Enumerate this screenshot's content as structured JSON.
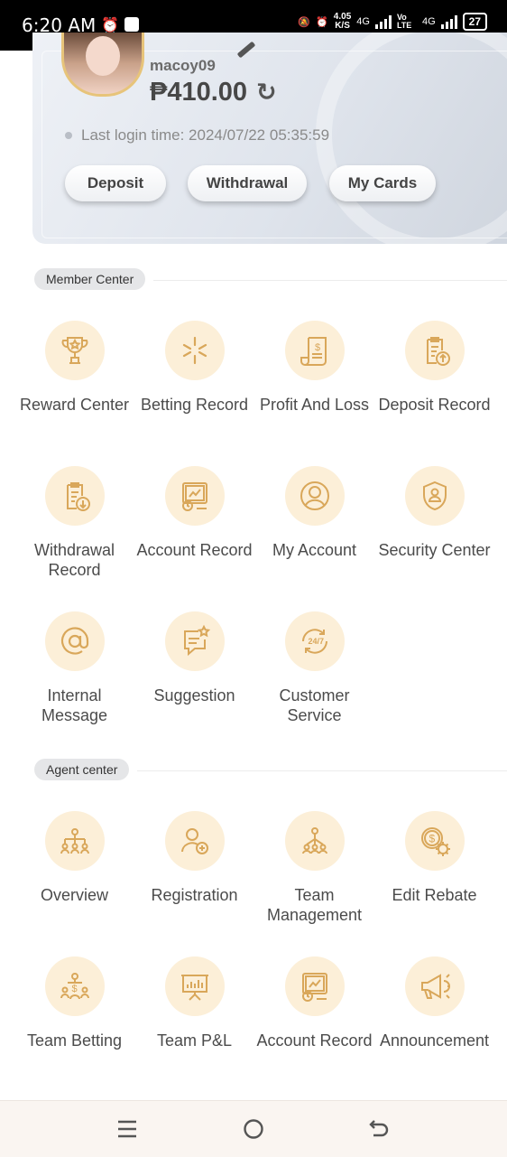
{
  "status_bar": {
    "time": "6:20 AM",
    "speed": "4.05",
    "speed_unit": "K/S",
    "net1": "4G",
    "net2": "Vo LTE",
    "net3": "4G",
    "battery": "27"
  },
  "profile": {
    "username": "macoy09",
    "balance": "₱410.00",
    "last_login": "Last login time: 2024/07/22 05:35:59",
    "buttons": {
      "deposit": "Deposit",
      "withdrawal": "Withdrawal",
      "my_cards": "My Cards"
    }
  },
  "member_center": {
    "title": "Member Center",
    "items": [
      {
        "label": "Reward Center",
        "icon": "trophy-icon"
      },
      {
        "label": "Betting Record",
        "icon": "star-burst-icon"
      },
      {
        "label": "Profit And Loss",
        "icon": "receipt-icon"
      },
      {
        "label": "Deposit Record",
        "icon": "clipboard-upload-icon"
      },
      {
        "label": "Withdrawal Record",
        "icon": "clipboard-download-icon"
      },
      {
        "label": "Account Record",
        "icon": "monitor-chart-icon"
      },
      {
        "label": "My Account",
        "icon": "user-circle-icon"
      },
      {
        "label": "Security Center",
        "icon": "shield-user-icon"
      },
      {
        "label": "Internal Message",
        "icon": "at-sign-icon"
      },
      {
        "label": "Suggestion",
        "icon": "chat-star-icon"
      },
      {
        "label": "Customer Service",
        "icon": "support-24-7-icon"
      }
    ]
  },
  "agent_center": {
    "title": "Agent center",
    "items": [
      {
        "label": "Overview",
        "icon": "org-chart-icon"
      },
      {
        "label": "Registration",
        "icon": "add-user-icon"
      },
      {
        "label": "Team Management",
        "icon": "team-network-icon"
      },
      {
        "label": "Edit Rebate",
        "icon": "coin-gear-icon"
      },
      {
        "label": "Team Betting",
        "icon": "team-money-icon"
      },
      {
        "label": "Team P&L",
        "icon": "presentation-chart-icon"
      },
      {
        "label": "Account Record",
        "icon": "monitor-chart-icon"
      },
      {
        "label": "Announcement",
        "icon": "megaphone-icon"
      }
    ]
  },
  "nav": {
    "menu": "recent-apps-icon",
    "home": "home-icon",
    "back": "back-icon"
  },
  "colors": {
    "icon_bg": "#fcefd8",
    "icon_stroke": "#d9a75a",
    "status_bar": "#000000"
  }
}
